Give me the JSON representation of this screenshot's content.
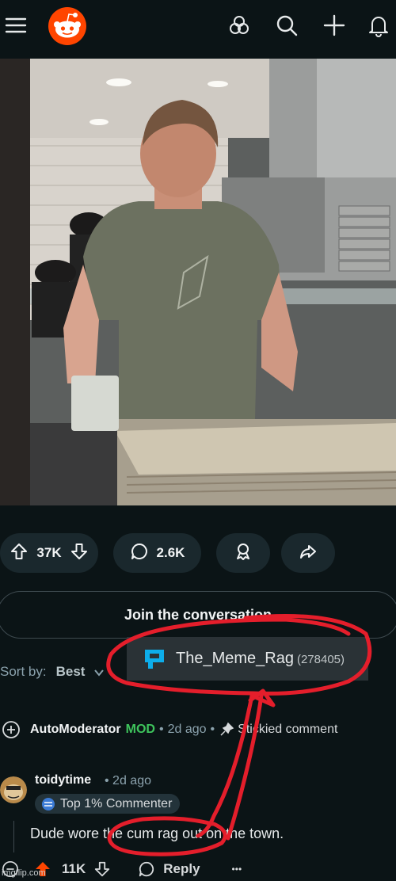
{
  "actions": {
    "upvotes": "37K",
    "comments": "2.6K"
  },
  "join_prompt": "Join the conversation",
  "sort": {
    "label": "Sort by:",
    "value": "Best"
  },
  "tooltip": {
    "name": "The_Meme_Rag",
    "count": "(278405)"
  },
  "automod": {
    "username": "AutoModerator",
    "badge": "MOD",
    "time": "2d ago",
    "sep": "•",
    "status": "Stickied comment"
  },
  "comment": {
    "username": "toidytime",
    "time": "• 2d ago",
    "flair": "Top 1% Commenter",
    "text": "Dude wore the cum rag out on the town.",
    "score": "11K",
    "reply_label": "Reply",
    "more": "•••"
  },
  "watermark": "imgflip.com",
  "colors": {
    "background": "#0b1416",
    "reddit_orange": "#ff4500",
    "mod_green": "#3ec45c",
    "annotation_red": "#e41e2b",
    "tooltip_icon": "#0dadea"
  },
  "icons": [
    "menu-icon",
    "reddit-logo",
    "communities-icon",
    "search-icon",
    "plus-icon",
    "bell-icon",
    "upvote-icon",
    "downvote-icon",
    "comment-icon",
    "award-icon",
    "share-icon"
  ]
}
